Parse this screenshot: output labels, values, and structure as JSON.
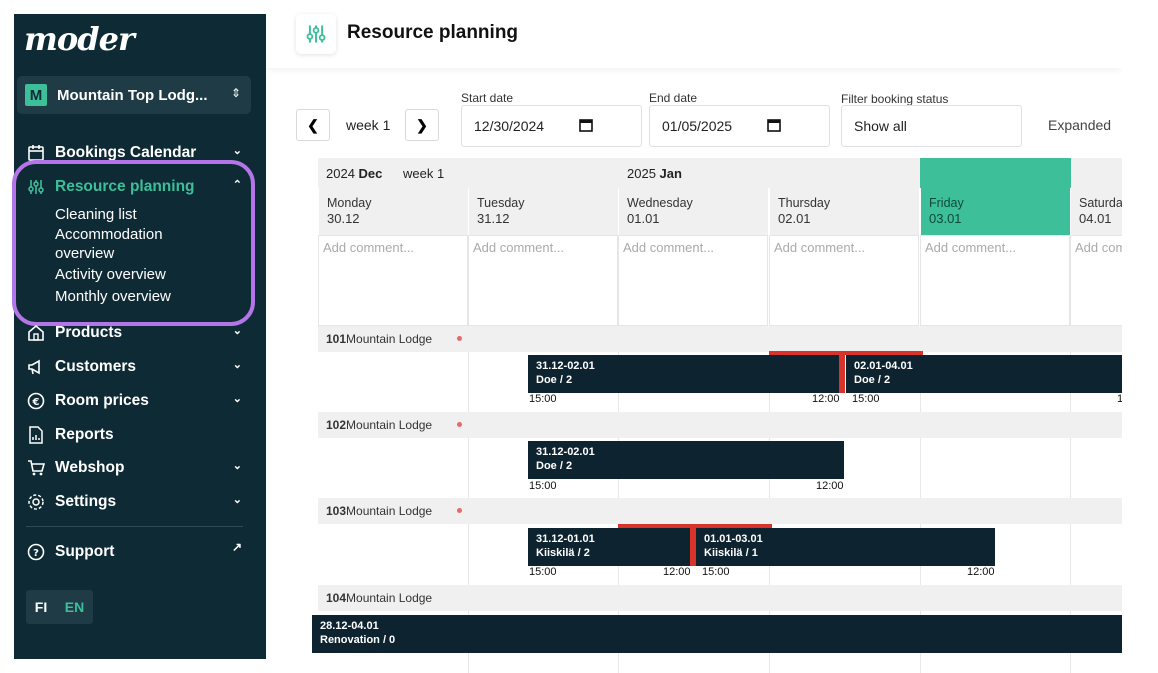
{
  "app": {
    "logo": "moder",
    "org_badge": "M",
    "org_name": "Mountain Top Lodg...",
    "lang_fi": "FI",
    "lang_en": "EN"
  },
  "nav": {
    "bookings": "Bookings Calendar",
    "resource": "Resource planning",
    "sub": [
      "Cleaning list",
      "Accommodation overview",
      "Activity overview",
      "Monthly overview"
    ],
    "products": "Products",
    "customers": "Customers",
    "room_prices": "Room prices",
    "reports": "Reports",
    "webshop": "Webshop",
    "settings": "Settings",
    "support": "Support"
  },
  "header": {
    "title": "Resource planning"
  },
  "toolbar": {
    "week_label": "week 1",
    "start_label": "Start date",
    "start_value": "12/30/2024",
    "end_label": "End date",
    "end_value": "01/05/2025",
    "filter_label": "Filter booking status",
    "filter_value": "Show all",
    "expanded": "Expanded"
  },
  "calendar": {
    "year1": "2024",
    "month1": "Dec",
    "week": "week 1",
    "year2": "2025",
    "month2": "Jan",
    "comment_placeholder": "Add comment...",
    "days": [
      {
        "name": "Monday",
        "date": "30.12"
      },
      {
        "name": "Tuesday",
        "date": "31.12"
      },
      {
        "name": "Wednesday",
        "date": "01.01"
      },
      {
        "name": "Thursday",
        "date": "02.01"
      },
      {
        "name": "Friday",
        "date": "03.01"
      },
      {
        "name": "Saturday",
        "date": "04.01"
      }
    ],
    "rooms": [
      {
        "number": "101",
        "name": "Mountain Lodge"
      },
      {
        "number": "102",
        "name": "Mountain Lodge"
      },
      {
        "number": "103",
        "name": "Mountain Lodge"
      },
      {
        "number": "104",
        "name": "Mountain Lodge"
      }
    ],
    "bookings": [
      {
        "dates": "31.12-02.01",
        "guest": "Doe / 2",
        "start": "15:00",
        "end": "12:00"
      },
      {
        "dates": "02.01-04.01",
        "guest": "Doe / 2",
        "start": "15:00",
        "end": "1"
      },
      {
        "dates": "31.12-02.01",
        "guest": "Doe / 2",
        "start": "15:00",
        "end": "12:00"
      },
      {
        "dates": "31.12-01.01",
        "guest": "Kiiskilä / 2",
        "start": "15:00",
        "end": "12:00"
      },
      {
        "dates": "01.01-03.01",
        "guest": "Kiiskilä / 1",
        "start": "15:00",
        "end": "12:00"
      },
      {
        "dates": "28.12-04.01",
        "guest": "Renovation / 0",
        "start": "",
        "end": ""
      }
    ]
  },
  "colors": {
    "sidebar": "#0e2a35",
    "accent": "#3dbf9a",
    "highlight": "#b475e8",
    "booking": "#0e2330",
    "conflict": "#d9342b"
  }
}
